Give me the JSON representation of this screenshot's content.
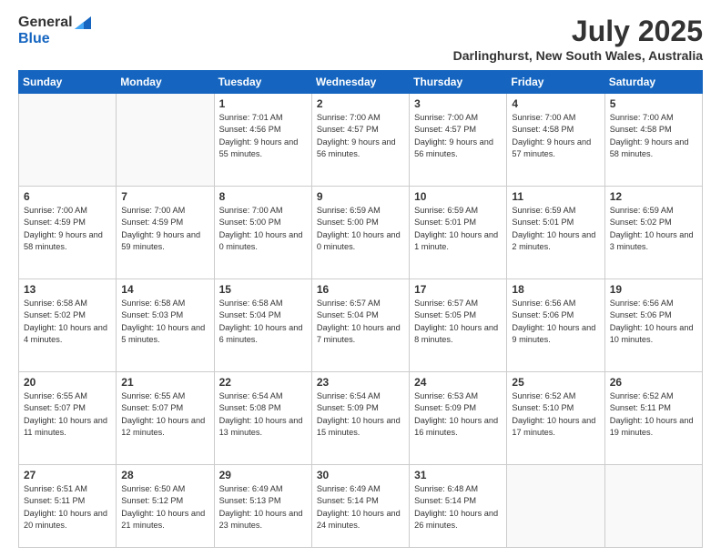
{
  "header": {
    "logo_general": "General",
    "logo_blue": "Blue",
    "month_title": "July 2025",
    "location": "Darlinghurst, New South Wales, Australia"
  },
  "weekdays": [
    "Sunday",
    "Monday",
    "Tuesday",
    "Wednesday",
    "Thursday",
    "Friday",
    "Saturday"
  ],
  "weeks": [
    [
      {
        "day": "",
        "info": ""
      },
      {
        "day": "",
        "info": ""
      },
      {
        "day": "1",
        "info": "Sunrise: 7:01 AM\nSunset: 4:56 PM\nDaylight: 9 hours and 55 minutes."
      },
      {
        "day": "2",
        "info": "Sunrise: 7:00 AM\nSunset: 4:57 PM\nDaylight: 9 hours and 56 minutes."
      },
      {
        "day": "3",
        "info": "Sunrise: 7:00 AM\nSunset: 4:57 PM\nDaylight: 9 hours and 56 minutes."
      },
      {
        "day": "4",
        "info": "Sunrise: 7:00 AM\nSunset: 4:58 PM\nDaylight: 9 hours and 57 minutes."
      },
      {
        "day": "5",
        "info": "Sunrise: 7:00 AM\nSunset: 4:58 PM\nDaylight: 9 hours and 58 minutes."
      }
    ],
    [
      {
        "day": "6",
        "info": "Sunrise: 7:00 AM\nSunset: 4:59 PM\nDaylight: 9 hours and 58 minutes."
      },
      {
        "day": "7",
        "info": "Sunrise: 7:00 AM\nSunset: 4:59 PM\nDaylight: 9 hours and 59 minutes."
      },
      {
        "day": "8",
        "info": "Sunrise: 7:00 AM\nSunset: 5:00 PM\nDaylight: 10 hours and 0 minutes."
      },
      {
        "day": "9",
        "info": "Sunrise: 6:59 AM\nSunset: 5:00 PM\nDaylight: 10 hours and 0 minutes."
      },
      {
        "day": "10",
        "info": "Sunrise: 6:59 AM\nSunset: 5:01 PM\nDaylight: 10 hours and 1 minute."
      },
      {
        "day": "11",
        "info": "Sunrise: 6:59 AM\nSunset: 5:01 PM\nDaylight: 10 hours and 2 minutes."
      },
      {
        "day": "12",
        "info": "Sunrise: 6:59 AM\nSunset: 5:02 PM\nDaylight: 10 hours and 3 minutes."
      }
    ],
    [
      {
        "day": "13",
        "info": "Sunrise: 6:58 AM\nSunset: 5:02 PM\nDaylight: 10 hours and 4 minutes."
      },
      {
        "day": "14",
        "info": "Sunrise: 6:58 AM\nSunset: 5:03 PM\nDaylight: 10 hours and 5 minutes."
      },
      {
        "day": "15",
        "info": "Sunrise: 6:58 AM\nSunset: 5:04 PM\nDaylight: 10 hours and 6 minutes."
      },
      {
        "day": "16",
        "info": "Sunrise: 6:57 AM\nSunset: 5:04 PM\nDaylight: 10 hours and 7 minutes."
      },
      {
        "day": "17",
        "info": "Sunrise: 6:57 AM\nSunset: 5:05 PM\nDaylight: 10 hours and 8 minutes."
      },
      {
        "day": "18",
        "info": "Sunrise: 6:56 AM\nSunset: 5:06 PM\nDaylight: 10 hours and 9 minutes."
      },
      {
        "day": "19",
        "info": "Sunrise: 6:56 AM\nSunset: 5:06 PM\nDaylight: 10 hours and 10 minutes."
      }
    ],
    [
      {
        "day": "20",
        "info": "Sunrise: 6:55 AM\nSunset: 5:07 PM\nDaylight: 10 hours and 11 minutes."
      },
      {
        "day": "21",
        "info": "Sunrise: 6:55 AM\nSunset: 5:07 PM\nDaylight: 10 hours and 12 minutes."
      },
      {
        "day": "22",
        "info": "Sunrise: 6:54 AM\nSunset: 5:08 PM\nDaylight: 10 hours and 13 minutes."
      },
      {
        "day": "23",
        "info": "Sunrise: 6:54 AM\nSunset: 5:09 PM\nDaylight: 10 hours and 15 minutes."
      },
      {
        "day": "24",
        "info": "Sunrise: 6:53 AM\nSunset: 5:09 PM\nDaylight: 10 hours and 16 minutes."
      },
      {
        "day": "25",
        "info": "Sunrise: 6:52 AM\nSunset: 5:10 PM\nDaylight: 10 hours and 17 minutes."
      },
      {
        "day": "26",
        "info": "Sunrise: 6:52 AM\nSunset: 5:11 PM\nDaylight: 10 hours and 19 minutes."
      }
    ],
    [
      {
        "day": "27",
        "info": "Sunrise: 6:51 AM\nSunset: 5:11 PM\nDaylight: 10 hours and 20 minutes."
      },
      {
        "day": "28",
        "info": "Sunrise: 6:50 AM\nSunset: 5:12 PM\nDaylight: 10 hours and 21 minutes."
      },
      {
        "day": "29",
        "info": "Sunrise: 6:49 AM\nSunset: 5:13 PM\nDaylight: 10 hours and 23 minutes."
      },
      {
        "day": "30",
        "info": "Sunrise: 6:49 AM\nSunset: 5:14 PM\nDaylight: 10 hours and 24 minutes."
      },
      {
        "day": "31",
        "info": "Sunrise: 6:48 AM\nSunset: 5:14 PM\nDaylight: 10 hours and 26 minutes."
      },
      {
        "day": "",
        "info": ""
      },
      {
        "day": "",
        "info": ""
      }
    ]
  ]
}
